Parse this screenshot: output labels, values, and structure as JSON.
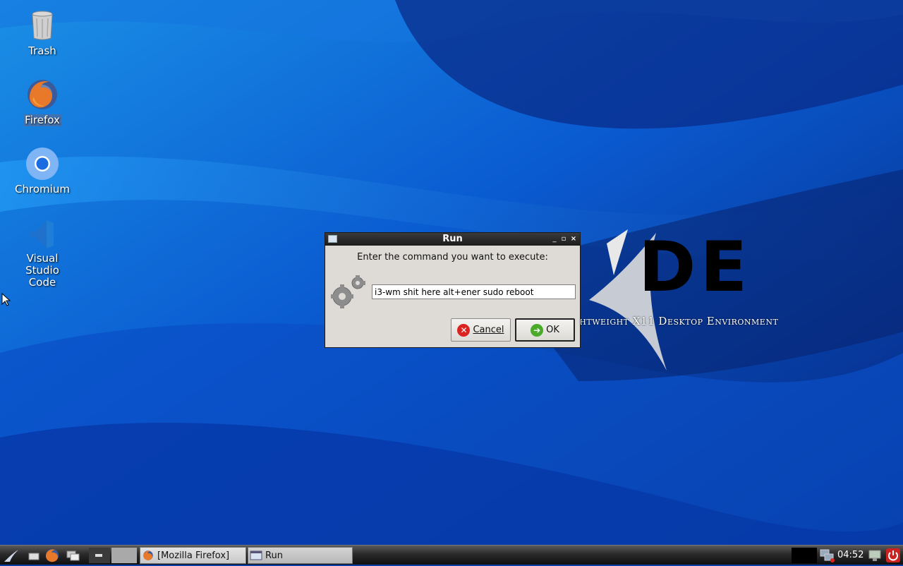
{
  "desktop": {
    "icons": [
      {
        "label": "Trash",
        "icon": "trash-icon"
      },
      {
        "label": "Firefox",
        "icon": "firefox-icon",
        "selected": true
      },
      {
        "label": "Chromium",
        "icon": "chromium-icon"
      },
      {
        "label": "Visual Studio\nCode",
        "icon": "vscode-icon"
      }
    ]
  },
  "wallpaper": {
    "logo_text": "DE",
    "tagline": "ghtweight X11 Desktop Environment"
  },
  "run_dialog": {
    "title": "Run",
    "prompt": "Enter the command you want to execute:",
    "command_value": "i3-wm shit here alt+ener sudo reboot",
    "cancel_label": "Cancel",
    "ok_label": "OK",
    "gear_icon": "gear-icon"
  },
  "taskbar": {
    "tasks": [
      {
        "label": "[Mozilla Firefox]",
        "icon": "firefox-icon"
      },
      {
        "label": "Run",
        "icon": "window-icon"
      }
    ],
    "clock": "04:52"
  },
  "colors": {
    "wallpaper_blue": "#0a3fa8",
    "dialog_bg": "#dedbd6",
    "titlebar": "#1c1c1c"
  }
}
